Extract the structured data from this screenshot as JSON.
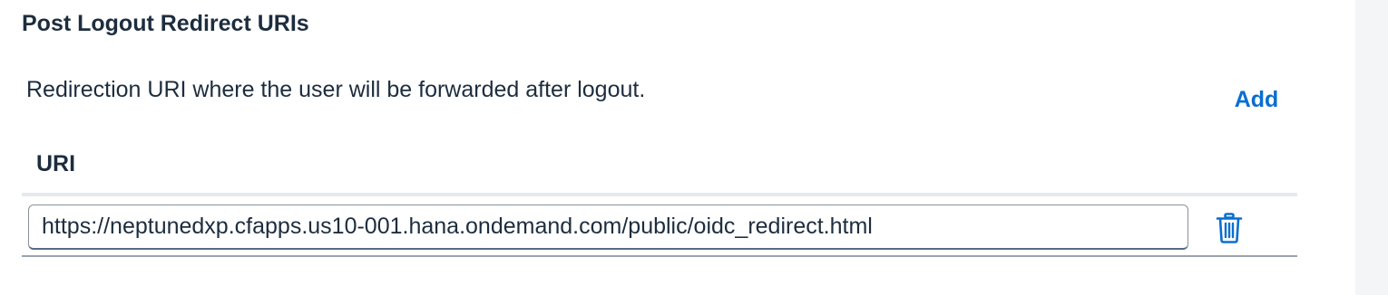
{
  "section": {
    "title": "Post Logout Redirect URIs",
    "description": "Redirection URI where the user will be forwarded after logout.",
    "add_label": "Add"
  },
  "table": {
    "columns": [
      "URI"
    ],
    "rows": [
      {
        "uri": "https://neptunedxp.cfapps.us10-001.hana.ondemand.com/public/oidc_redirect.html"
      }
    ]
  },
  "icons": {
    "delete": "trash-icon"
  },
  "colors": {
    "accent": "#0a6ed1",
    "text": "#1d2d3e",
    "rail": "#f4f5f6"
  }
}
